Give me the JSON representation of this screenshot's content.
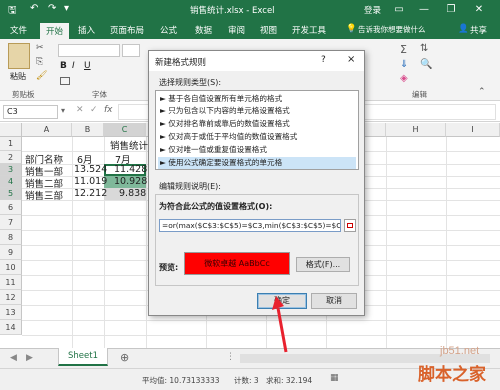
{
  "window": {
    "title": "销售统计.xlsx - Excel",
    "login_label": "登录"
  },
  "ribbon_tabs": [
    "文件",
    "开始",
    "插入",
    "页面布局",
    "公式",
    "数据",
    "审阅",
    "视图",
    "开发工具"
  ],
  "tell_me": "告诉我你想要做什么",
  "share_label": "共享",
  "ribbon_groups": {
    "paste": "粘贴",
    "clipboard": "剪贴板",
    "font": "字体",
    "editing": "编辑"
  },
  "name_box": "C3",
  "columns": [
    "A",
    "B",
    "C",
    "D",
    "E",
    "F",
    "G",
    "H",
    "I"
  ],
  "rows": [
    "1",
    "2",
    "3",
    "4",
    "5",
    "6",
    "7",
    "8",
    "9",
    "10",
    "11",
    "12",
    "13",
    "14"
  ],
  "cells": {
    "c1": "销售统计",
    "a2": "部门名称",
    "b2": "6月",
    "c2": "7月",
    "a3": "销售一部",
    "b3": "13.524",
    "c3": "11.428",
    "a4": "销售二部",
    "b4": "11.019",
    "c4": "10.928",
    "a5": "销售三部",
    "b5": "12.212",
    "c5": "9.838"
  },
  "sheet_tab": "Sheet1",
  "status": {
    "average": "平均值: 10.73133333",
    "count": "计数: 3",
    "sum": "求和: 32.194"
  },
  "watermark": {
    "site": "jb51.net",
    "brand": "脚本之家"
  },
  "dialog": {
    "title": "新建格式规则",
    "help": "?",
    "close": "×",
    "select_type_label": "选择规则类型(S):",
    "rule_types": [
      "► 基于各自值设置所有单元格的格式",
      "► 只为包含以下内容的单元格设置格式",
      "► 仅对排名靠前或靠后的数值设置格式",
      "► 仅对高于或低于平均值的数值设置格式",
      "► 仅对唯一值或重复值设置格式",
      "► 使用公式确定要设置格式的单元格"
    ],
    "edit_desc_label": "编辑规则说明(E):",
    "formula_label": "为符合此公式的值设置格式(O):",
    "formula_value": "=or(max($C$3:$C$5)=$C3,min($C$3:$C$5)=$C3)",
    "preview_label": "预览:",
    "preview_text": "微软卓越  AaBbCc",
    "format_button": "格式(F)...",
    "ok_button": "确定",
    "cancel_button": "取消"
  },
  "colors": {
    "excel_green": "#217346",
    "preview_fill": "#ff0000",
    "cell_highlight": "#7fb89a",
    "arrow": "#e8212e"
  }
}
